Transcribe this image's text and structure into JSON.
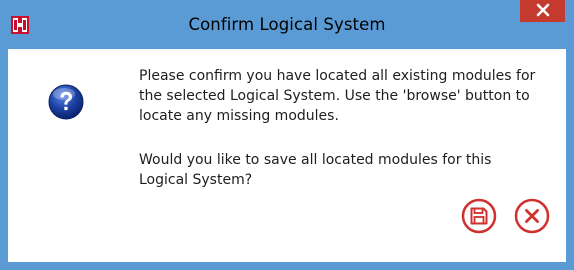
{
  "window": {
    "title": "Confirm Logical System",
    "icons": {
      "app": "binoculars-icon",
      "close": "close-icon",
      "question": "question-icon",
      "save": "floppy-disk-icon",
      "cancel": "cancel-icon"
    },
    "colors": {
      "titlebar": "#5b9bd5",
      "close_button": "#c53a2e",
      "action_red": "#d0302e",
      "question_blue": "#1a3fa0"
    }
  },
  "dialog": {
    "line1": "Please confirm you have located all existing modules for",
    "line2": "the selected Logical System.  Use the 'browse' button to",
    "line3": "locate any missing modules.",
    "line4": "Would you like to save all located modules for this",
    "line5": "Logical System?"
  }
}
